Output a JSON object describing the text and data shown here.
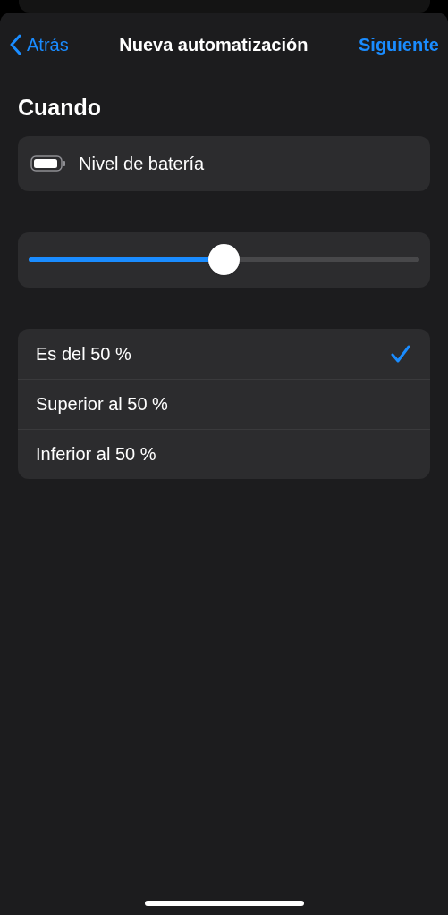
{
  "nav": {
    "back": "Atrás",
    "title": "Nueva automatización",
    "next": "Siguiente"
  },
  "section_title": "Cuando",
  "trigger": {
    "label": "Nivel de batería"
  },
  "slider": {
    "level": 0.5
  },
  "options": [
    {
      "label": "Es del 50 %",
      "selected": true
    },
    {
      "label": "Superior al 50 %",
      "selected": false
    },
    {
      "label": "Inferior al 50 %",
      "selected": false
    }
  ]
}
